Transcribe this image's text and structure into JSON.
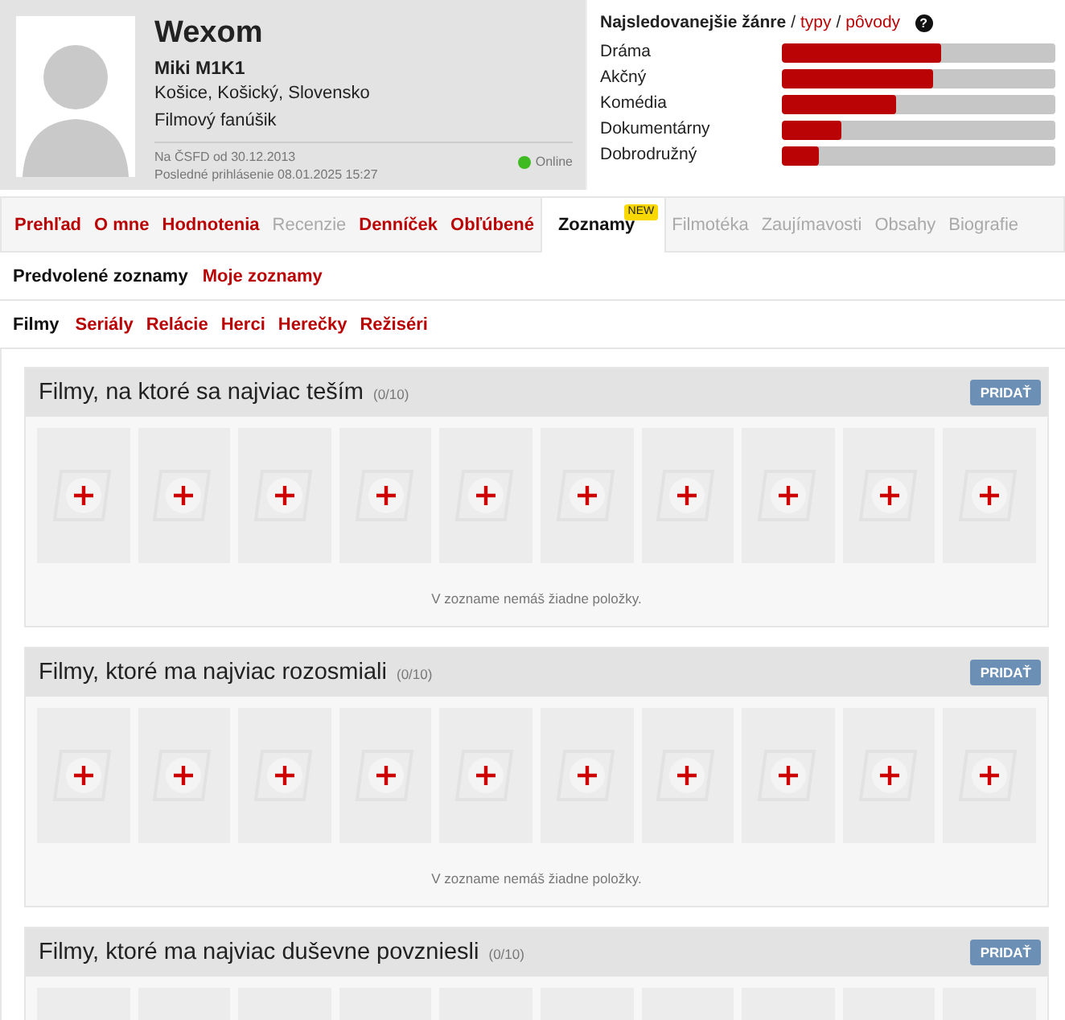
{
  "profile": {
    "username": "Wexom",
    "name": "Miki M1K1",
    "location": "Košice, Košický, Slovensko",
    "rank": "Filmový fanúšik",
    "member_since": "Na ČSFD od 30.12.2013",
    "last_login": "Posledné prihlásenie 08.01.2025 15:27",
    "online": true,
    "status": "Online"
  },
  "genres": {
    "title": "Najsledovanejšie žánre",
    "sep1": "/",
    "link1": "typy",
    "sep2": "/",
    "link2": "pôvody",
    "help": "?",
    "items": [
      {
        "label": "Dráma",
        "level": 0.58
      },
      {
        "label": "Akčný",
        "level": 0.55
      },
      {
        "label": "Komédia",
        "level": 0.42
      },
      {
        "label": "Dokumentárny",
        "level": 0.22
      },
      {
        "label": "Dobrodružný",
        "level": 0.135
      }
    ]
  },
  "tabs": [
    {
      "label": "Prehľad",
      "selected": false,
      "disabled": false
    },
    {
      "label": "O mne",
      "selected": false,
      "disabled": false
    },
    {
      "label": "Hodnotenia",
      "selected": false,
      "disabled": false
    },
    {
      "label": "Recenzie",
      "selected": false,
      "disabled": true
    },
    {
      "label": "Denníček",
      "selected": false,
      "disabled": false
    },
    {
      "label": "Obľúbené",
      "selected": false,
      "disabled": false
    },
    {
      "label": "Zoznamy",
      "selected": true,
      "disabled": false,
      "badge": "NEW"
    },
    {
      "label": "Filmotéka",
      "selected": false,
      "disabled": true
    },
    {
      "label": "Zaujímavosti",
      "selected": false,
      "disabled": true
    },
    {
      "label": "Obsahy",
      "selected": false,
      "disabled": true
    },
    {
      "label": "Biografie",
      "selected": false,
      "disabled": true
    }
  ],
  "subtabs": [
    {
      "label": "Predvolené zoznamy",
      "selected": true
    },
    {
      "label": "Moje zoznamy",
      "selected": false
    }
  ],
  "categories": [
    {
      "label": "Filmy",
      "selected": true
    },
    {
      "label": "Seriály",
      "selected": false
    },
    {
      "label": "Relácie",
      "selected": false
    },
    {
      "label": "Herci",
      "selected": false
    },
    {
      "label": "Herečky",
      "selected": false
    },
    {
      "label": "Režiséri",
      "selected": false
    }
  ],
  "lists": [
    {
      "title": "Filmy, na ktoré sa najviac teším",
      "count": "(0/10)",
      "button": "PRIDAŤ",
      "empty_text": "V zozname nemáš žiadne položky."
    },
    {
      "title": "Filmy, ktoré ma najviac rozosmiali",
      "count": "(0/10)",
      "button": "PRIDAŤ",
      "empty_text": "V zozname nemáš žiadne položky."
    },
    {
      "title": "Filmy, ktoré ma najviac duševne povzniesli",
      "count": "(0/10)",
      "button": "PRIDAŤ"
    }
  ]
}
